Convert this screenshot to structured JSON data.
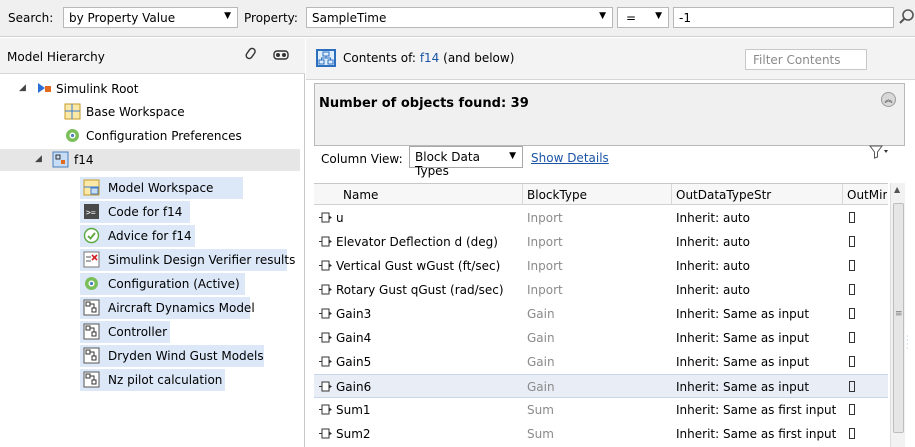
{
  "search": {
    "search_label": "Search:",
    "search_by": "by Property Value",
    "property_label": "Property:",
    "property_value": "SampleTime",
    "operator": "=",
    "value": "-1"
  },
  "hierarchy": {
    "title": "Model Hierarchy",
    "items": [
      {
        "label": "Simulink Root"
      },
      {
        "label": "Base Workspace"
      },
      {
        "label": "Configuration Preferences"
      },
      {
        "label": "f14"
      },
      {
        "label": "Model Workspace"
      },
      {
        "label": "Code for f14"
      },
      {
        "label": "Advice for f14"
      },
      {
        "label": "Simulink Design Verifier results"
      },
      {
        "label": "Configuration (Active)"
      },
      {
        "label": "Aircraft Dynamics Model"
      },
      {
        "label": "Controller"
      },
      {
        "label": "Dryden Wind Gust Models"
      },
      {
        "label": "Nz pilot calculation"
      }
    ]
  },
  "contents": {
    "prefix": "Contents of:",
    "model": "f14",
    "suffix": "(and below)",
    "filter_placeholder": "Filter Contents",
    "found_text": "Number of objects found: 39",
    "column_view_label": "Column View:",
    "column_view_value": "Block Data Types",
    "show_details": "Show Details"
  },
  "table": {
    "columns": [
      "Name",
      "BlockType",
      "OutDataTypeStr",
      "OutMir"
    ],
    "rows": [
      {
        "name": "u",
        "type": "Inport",
        "out": "Inherit: auto"
      },
      {
        "name": "Elevator Deflection d (deg)",
        "type": "Inport",
        "out": "Inherit: auto"
      },
      {
        "name": "Vertical Gust wGust (ft/sec)",
        "type": "Inport",
        "out": "Inherit: auto"
      },
      {
        "name": "Rotary Gust qGust (rad/sec)",
        "type": "Inport",
        "out": "Inherit: auto"
      },
      {
        "name": "Gain3",
        "type": "Gain",
        "out": "Inherit: Same as input"
      },
      {
        "name": "Gain4",
        "type": "Gain",
        "out": "Inherit: Same as input"
      },
      {
        "name": "Gain5",
        "type": "Gain",
        "out": "Inherit: Same as input"
      },
      {
        "name": "Gain6",
        "type": "Gain",
        "out": "Inherit: Same as input"
      },
      {
        "name": "Sum1",
        "type": "Sum",
        "out": "Inherit: Same as first input"
      },
      {
        "name": "Sum2",
        "type": "Sum",
        "out": "Inherit: Same as first input"
      }
    ]
  },
  "colors": {
    "link": "#1a54a6",
    "highlight": "#dce8f8",
    "selected_row": "#e9eef6"
  }
}
